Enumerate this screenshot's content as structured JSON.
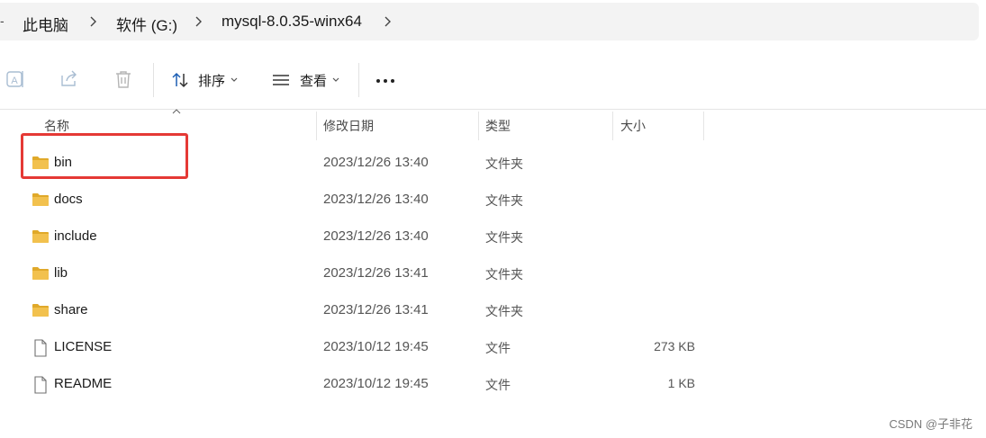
{
  "address_bar": {
    "lead": "-",
    "breadcrumbs": [
      {
        "label": "此电脑"
      },
      {
        "label": "软件 (G:)"
      },
      {
        "label": "mysql-8.0.35-winx64"
      }
    ]
  },
  "toolbar": {
    "icons": [
      "rename-icon",
      "share-icon",
      "delete-icon"
    ],
    "sort_label": "排序",
    "view_label": "查看"
  },
  "columns": {
    "name": "名称",
    "date": "修改日期",
    "type": "类型",
    "size": "大小"
  },
  "files": [
    {
      "name": "bin",
      "date": "2023/12/26 13:40",
      "type": "文件夹",
      "size": "",
      "kind": "folder"
    },
    {
      "name": "docs",
      "date": "2023/12/26 13:40",
      "type": "文件夹",
      "size": "",
      "kind": "folder"
    },
    {
      "name": "include",
      "date": "2023/12/26 13:40",
      "type": "文件夹",
      "size": "",
      "kind": "folder"
    },
    {
      "name": "lib",
      "date": "2023/12/26 13:41",
      "type": "文件夹",
      "size": "",
      "kind": "folder"
    },
    {
      "name": "share",
      "date": "2023/12/26 13:41",
      "type": "文件夹",
      "size": "",
      "kind": "folder"
    },
    {
      "name": "LICENSE",
      "date": "2023/10/12 19:45",
      "type": "文件",
      "size": "273 KB",
      "kind": "file"
    },
    {
      "name": "README",
      "date": "2023/10/12 19:45",
      "type": "文件",
      "size": "1 KB",
      "kind": "file"
    }
  ],
  "highlighted_item": "bin",
  "watermark": "CSDN @子非花",
  "colors": {
    "highlight": "#e53935",
    "folder": "#f2c14e",
    "folder_dark": "#e0a92a",
    "address_bg": "#f3f3f3"
  }
}
